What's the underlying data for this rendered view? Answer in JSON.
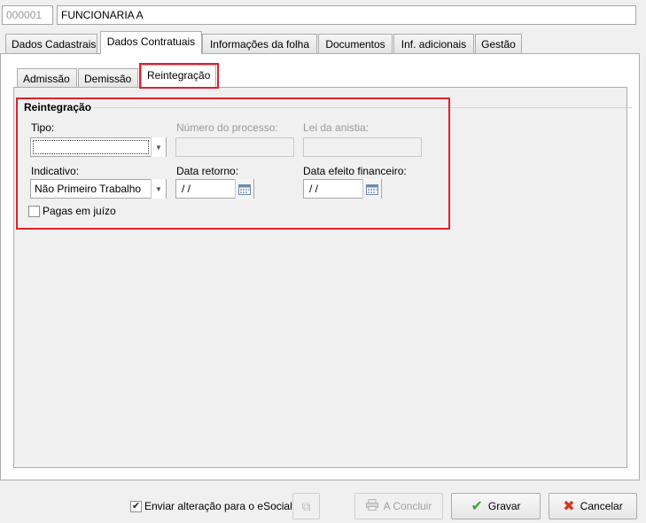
{
  "header": {
    "code": "000001",
    "name": "FUNCIONARIA A"
  },
  "main_tabs": [
    {
      "label": "Dados Cadastrais"
    },
    {
      "label": "Dados Contratuais"
    },
    {
      "label": "Informações da folha"
    },
    {
      "label": "Documentos"
    },
    {
      "label": "Inf. adicionais"
    },
    {
      "label": "Gestão"
    }
  ],
  "sub_tabs": [
    {
      "label": "Admissão"
    },
    {
      "label": "Demissão"
    },
    {
      "label": "Reintegração"
    }
  ],
  "section": {
    "title": "Reintegração",
    "tipo_label": "Tipo:",
    "tipo_value": "",
    "numero_processo_label": "Número do processo:",
    "numero_processo_value": "",
    "lei_anistia_label": "Lei da anistia:",
    "lei_anistia_value": "",
    "indicativo_label": "Indicativo:",
    "indicativo_value": "Não Primeiro Trabalho",
    "data_retorno_label": "Data retorno:",
    "data_retorno_value": " / /",
    "data_efeito_label": "Data efeito financeiro:",
    "data_efeito_value": " / /",
    "pagas_juizo_label": "Pagas em juízo",
    "pagas_juizo_checked": false
  },
  "footer": {
    "esocial_label": "Enviar alteração para o eSocial",
    "esocial_checked": true,
    "concluir_label": "A Concluir",
    "gravar_label": "Gravar",
    "cancelar_label": "Cancelar"
  },
  "colors": {
    "highlight": "#e0202a",
    "gravar_icon": "#3aa832",
    "cancelar_icon": "#d23a1e"
  }
}
